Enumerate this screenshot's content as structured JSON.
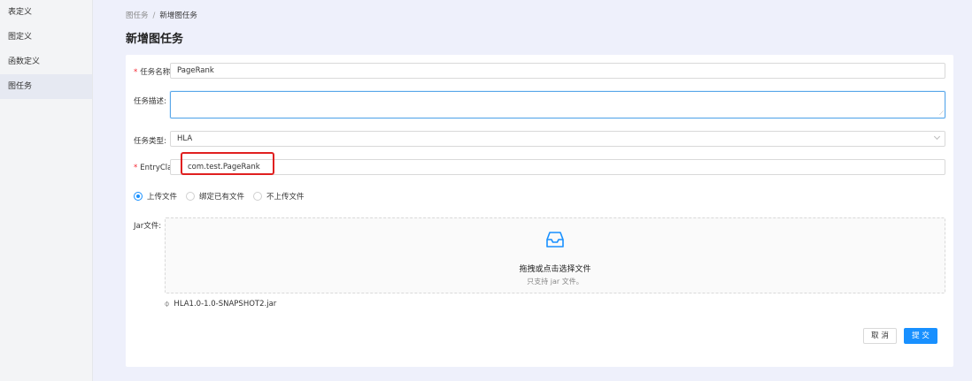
{
  "sidebar": {
    "items": [
      {
        "label": "表定义"
      },
      {
        "label": "图定义"
      },
      {
        "label": "函数定义"
      },
      {
        "label": "图任务"
      }
    ]
  },
  "breadcrumb": {
    "parent": "图任务",
    "separator": "/",
    "current": "新增图任务"
  },
  "page_title": "新增图任务",
  "form": {
    "name": {
      "label": "任务名称:",
      "value": "PageRank"
    },
    "description": {
      "label": "任务描述:",
      "value": ""
    },
    "type": {
      "label": "任务类型:",
      "value": "HLA"
    },
    "entry_class": {
      "label": "EntryClass",
      "value": "com.test.PageRank"
    },
    "upload_mode": {
      "options": [
        "上传文件",
        "绑定已有文件",
        "不上传文件"
      ],
      "selected": "上传文件"
    },
    "jar": {
      "label": "Jar文件:",
      "drop_text": "拖拽或点击选择文件",
      "hint": "只支持 jar 文件。",
      "file_name": "HLA1.0-1.0-SNAPSHOT2.jar"
    }
  },
  "actions": {
    "cancel": "取 消",
    "submit": "提 交"
  },
  "colors": {
    "primary": "#1890ff",
    "required": "#f5222d",
    "highlight": "#e02020"
  }
}
